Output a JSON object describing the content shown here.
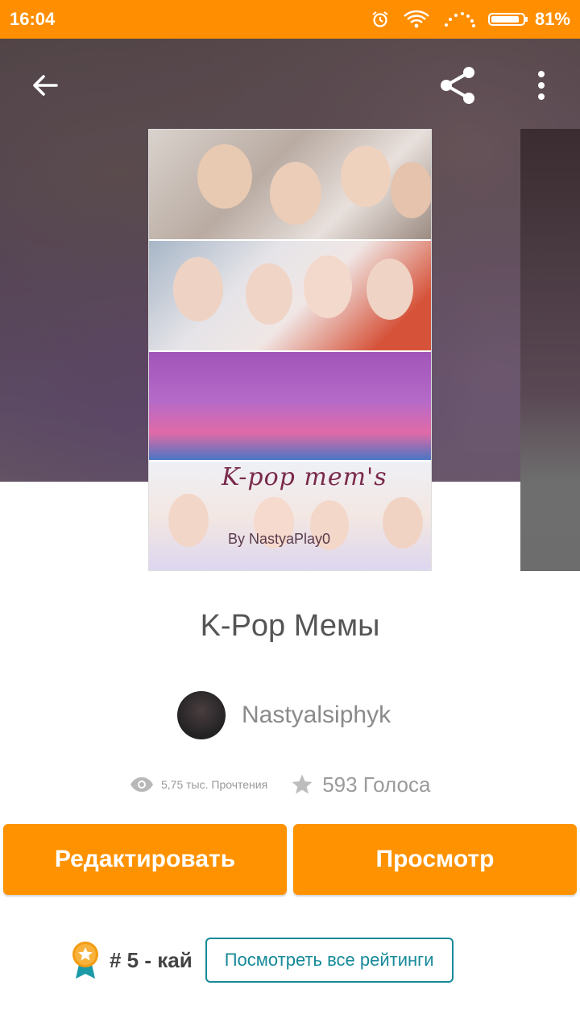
{
  "status_bar": {
    "time": "16:04",
    "battery": "81%",
    "bg_color": "#ff8f00"
  },
  "toolbar": {
    "back_icon": "arrow-back-icon",
    "share_icon": "share-icon",
    "more_icon": "more-vert-icon"
  },
  "cover": {
    "title_text": "K-pop mem's",
    "byline_text": "By NastyaPlay0"
  },
  "story": {
    "title": "K-Pop Мемы",
    "author": "Nastyalsiphyk",
    "reads": "5,75 тыс. Прочтения",
    "votes": "593 Голоса"
  },
  "actions": {
    "edit_label": "Редактировать",
    "view_label": "Просмотр",
    "accent_color": "#ff9200"
  },
  "ranking": {
    "rank_text": "# 5 - кай",
    "view_all_label": "Посмотреть все рейтинги",
    "link_color": "#168a99"
  }
}
